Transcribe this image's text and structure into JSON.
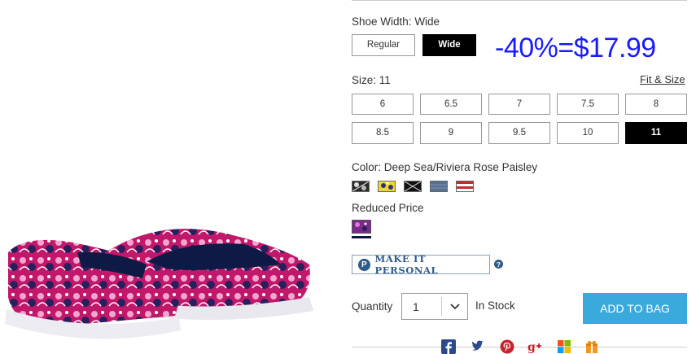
{
  "width": {
    "label": "Shoe Width:",
    "value": "Wide",
    "options": [
      "Regular",
      "Wide"
    ],
    "selected": "Wide"
  },
  "promo_text": "-40%=$17.99",
  "size": {
    "label": "Size:",
    "value": "11",
    "fit_link": "Fit & Size",
    "options": [
      "6",
      "6.5",
      "7",
      "7.5",
      "8",
      "8.5",
      "9",
      "9.5",
      "10",
      "11"
    ],
    "selected": "11"
  },
  "color": {
    "label": "Color:",
    "value": "Deep Sea/Riviera Rose Paisley",
    "swatch_count": 5
  },
  "reduced_price_label": "Reduced Price",
  "personal_button": "MAKE IT PERSONAL",
  "help_glyph": "?",
  "quantity": {
    "label": "Quantity",
    "value": "1",
    "stock": "In Stock"
  },
  "add_to_bag": "ADD TO BAG",
  "share_icons": [
    "facebook-icon",
    "twitter-icon",
    "pinterest-icon",
    "google-plus-icon",
    "microsoft-icon",
    "gift-icon"
  ],
  "colors": {
    "promo": "#1a1aff",
    "button_blue": "#3aaadc",
    "personal_blue": "#2e5b8a",
    "selected_black": "#000000"
  }
}
